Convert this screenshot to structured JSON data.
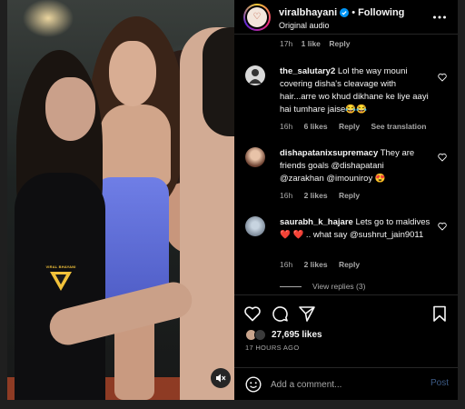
{
  "colors": {
    "accent": "#0095f6",
    "muted": "#a8a8a8",
    "like": "#ff3040",
    "background": "#000000"
  },
  "header": {
    "username": "viralbhayani",
    "separator": "•",
    "follow_status": "Following",
    "audio": "Original audio"
  },
  "media": {
    "watermark": "VIRAL BHAYANI"
  },
  "top_comment_meta": {
    "time": "17h",
    "likes": "1 like",
    "reply": "Reply"
  },
  "comments": [
    {
      "username": "the_salutary2",
      "text": "Lol the way mouni covering disha's cleavage with hair...arre wo khud dikhane ke liye aayi hai tumhare jaise😂😂",
      "time": "16h",
      "likes": "6 likes",
      "reply": "Reply",
      "extra": "See translation"
    },
    {
      "username": "dishapatanixsupremacy",
      "text": "They are friends goals @dishapatani @zarakhan @imouniroy 😍",
      "time": "16h",
      "likes": "2 likes",
      "reply": "Reply"
    },
    {
      "username": "saurabh_k_hajare",
      "text": "Lets go to maldives ❤️ ❤️ .. what say @sushrut_jain9011",
      "time": "16h",
      "likes": "2 likes",
      "reply": "Reply"
    }
  ],
  "view_replies": "View replies (3)",
  "actions": {
    "likes_count": "27,695 likes",
    "posted": "17 HOURS AGO"
  },
  "add_comment": {
    "placeholder": "Add a comment...",
    "post_label": "Post"
  }
}
